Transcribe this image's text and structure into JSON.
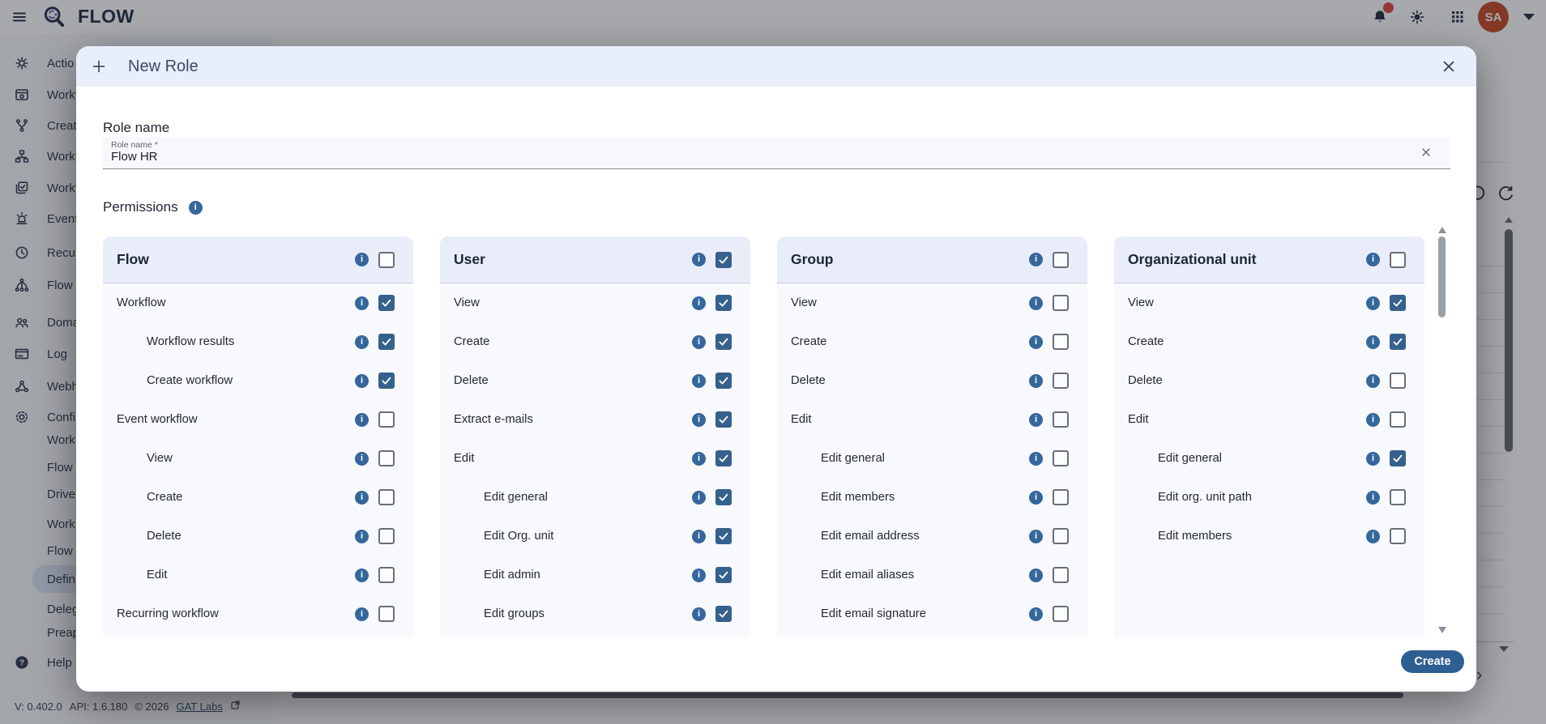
{
  "topbar": {
    "brand": "FLOW",
    "avatar": "SA",
    "icons": [
      "menu-icon",
      "flow-logo-icon",
      "bell-icon",
      "notification-dot",
      "brightness-icon",
      "apps-grid-icon",
      "caret-down-icon"
    ]
  },
  "sidebar": {
    "items": [
      {
        "label": "Actio",
        "icon": "actions-icon"
      },
      {
        "label": "Workf",
        "icon": "workflows-icon"
      },
      {
        "label": "Creat",
        "icon": "create-workflow-icon"
      },
      {
        "label": "Workf",
        "icon": "workflow-tree-icon"
      },
      {
        "label": "Workf",
        "icon": "workflow-results-icon"
      },
      {
        "label": "Event",
        "icon": "event-workflows-icon"
      },
      {
        "label": "Recu",
        "icon": "recurring-icon"
      },
      {
        "label": "Flow",
        "icon": "flow-nodes-icon"
      },
      {
        "label": "Doma",
        "icon": "domains-icon"
      },
      {
        "label": "Log",
        "icon": "log-icon"
      },
      {
        "label": "Webh",
        "icon": "webhooks-icon"
      },
      {
        "label": "Confi",
        "icon": "configuration-icon"
      },
      {
        "label": "Work",
        "icon": null
      },
      {
        "label": "Flow",
        "icon": null
      },
      {
        "label": "Drive",
        "icon": null
      },
      {
        "label": "Work",
        "icon": null
      },
      {
        "label": "Flow",
        "icon": null
      },
      {
        "label": "Defin",
        "icon": null,
        "selected": true
      },
      {
        "label": "Deleg",
        "icon": null
      },
      {
        "label": "Preap",
        "icon": null
      },
      {
        "label": "Help",
        "icon": "help-icon"
      }
    ],
    "footer": {
      "version": "V: 0.402.0",
      "api": "API: 1.6.180",
      "copyright": "© 2026",
      "link_label": "GAT Labs",
      "link_icon": "external-link-icon"
    }
  },
  "dialog": {
    "title": "New Role",
    "sections": {
      "role_name": "Role name",
      "permissions": "Permissions"
    },
    "field": {
      "label": "Role name *",
      "value": "Flow HR"
    },
    "create_label": "Create",
    "icons": [
      "plus-icon",
      "close-icon",
      "info-icon",
      "clear-icon",
      "checkmark-icon"
    ],
    "columns": [
      {
        "title": "Flow",
        "checked": false,
        "rows": [
          {
            "label": "Workflow",
            "indent": 0,
            "checked": true
          },
          {
            "label": "Workflow results",
            "indent": 1,
            "checked": true
          },
          {
            "label": "Create workflow",
            "indent": 1,
            "checked": true
          },
          {
            "label": "Event workflow",
            "indent": 0,
            "checked": false
          },
          {
            "label": "View",
            "indent": 1,
            "checked": false
          },
          {
            "label": "Create",
            "indent": 1,
            "checked": false
          },
          {
            "label": "Delete",
            "indent": 1,
            "checked": false
          },
          {
            "label": "Edit",
            "indent": 1,
            "checked": false
          },
          {
            "label": "Recurring workflow",
            "indent": 0,
            "checked": false
          }
        ]
      },
      {
        "title": "User",
        "checked": true,
        "rows": [
          {
            "label": "View",
            "indent": 0,
            "checked": true
          },
          {
            "label": "Create",
            "indent": 0,
            "checked": true
          },
          {
            "label": "Delete",
            "indent": 0,
            "checked": true
          },
          {
            "label": "Extract e-mails",
            "indent": 0,
            "checked": true
          },
          {
            "label": "Edit",
            "indent": 0,
            "checked": true
          },
          {
            "label": "Edit general",
            "indent": 1,
            "checked": true
          },
          {
            "label": "Edit Org. unit",
            "indent": 1,
            "checked": true
          },
          {
            "label": "Edit admin",
            "indent": 1,
            "checked": true
          },
          {
            "label": "Edit groups",
            "indent": 1,
            "checked": true
          }
        ]
      },
      {
        "title": "Group",
        "checked": false,
        "rows": [
          {
            "label": "View",
            "indent": 0,
            "checked": false
          },
          {
            "label": "Create",
            "indent": 0,
            "checked": false
          },
          {
            "label": "Delete",
            "indent": 0,
            "checked": false
          },
          {
            "label": "Edit",
            "indent": 0,
            "checked": false
          },
          {
            "label": "Edit general",
            "indent": 1,
            "checked": false
          },
          {
            "label": "Edit members",
            "indent": 1,
            "checked": false
          },
          {
            "label": "Edit email address",
            "indent": 1,
            "checked": false
          },
          {
            "label": "Edit email aliases",
            "indent": 1,
            "checked": false
          },
          {
            "label": "Edit email signature",
            "indent": 1,
            "checked": false
          }
        ]
      },
      {
        "title": "Organizational unit",
        "checked": false,
        "rows": [
          {
            "label": "View",
            "indent": 0,
            "checked": true
          },
          {
            "label": "Create",
            "indent": 0,
            "checked": true
          },
          {
            "label": "Delete",
            "indent": 0,
            "checked": false
          },
          {
            "label": "Edit",
            "indent": 0,
            "checked": false
          },
          {
            "label": "Edit general",
            "indent": 1,
            "checked": true
          },
          {
            "label": "Edit org. unit path",
            "indent": 1,
            "checked": false
          },
          {
            "label": "Edit members",
            "indent": 1,
            "checked": false
          }
        ]
      }
    ]
  },
  "colors": {
    "accent_checked": "#35618C",
    "info_icon": "#35679B",
    "create_button": "#2E5F92",
    "dialog_header": "#E9EEFB",
    "column_header": "#E9EDF9",
    "column_body": "#F7F9FD",
    "avatar": "#C6431F",
    "notification_dot": "#DB4437",
    "brand_text": "#1C2942"
  }
}
